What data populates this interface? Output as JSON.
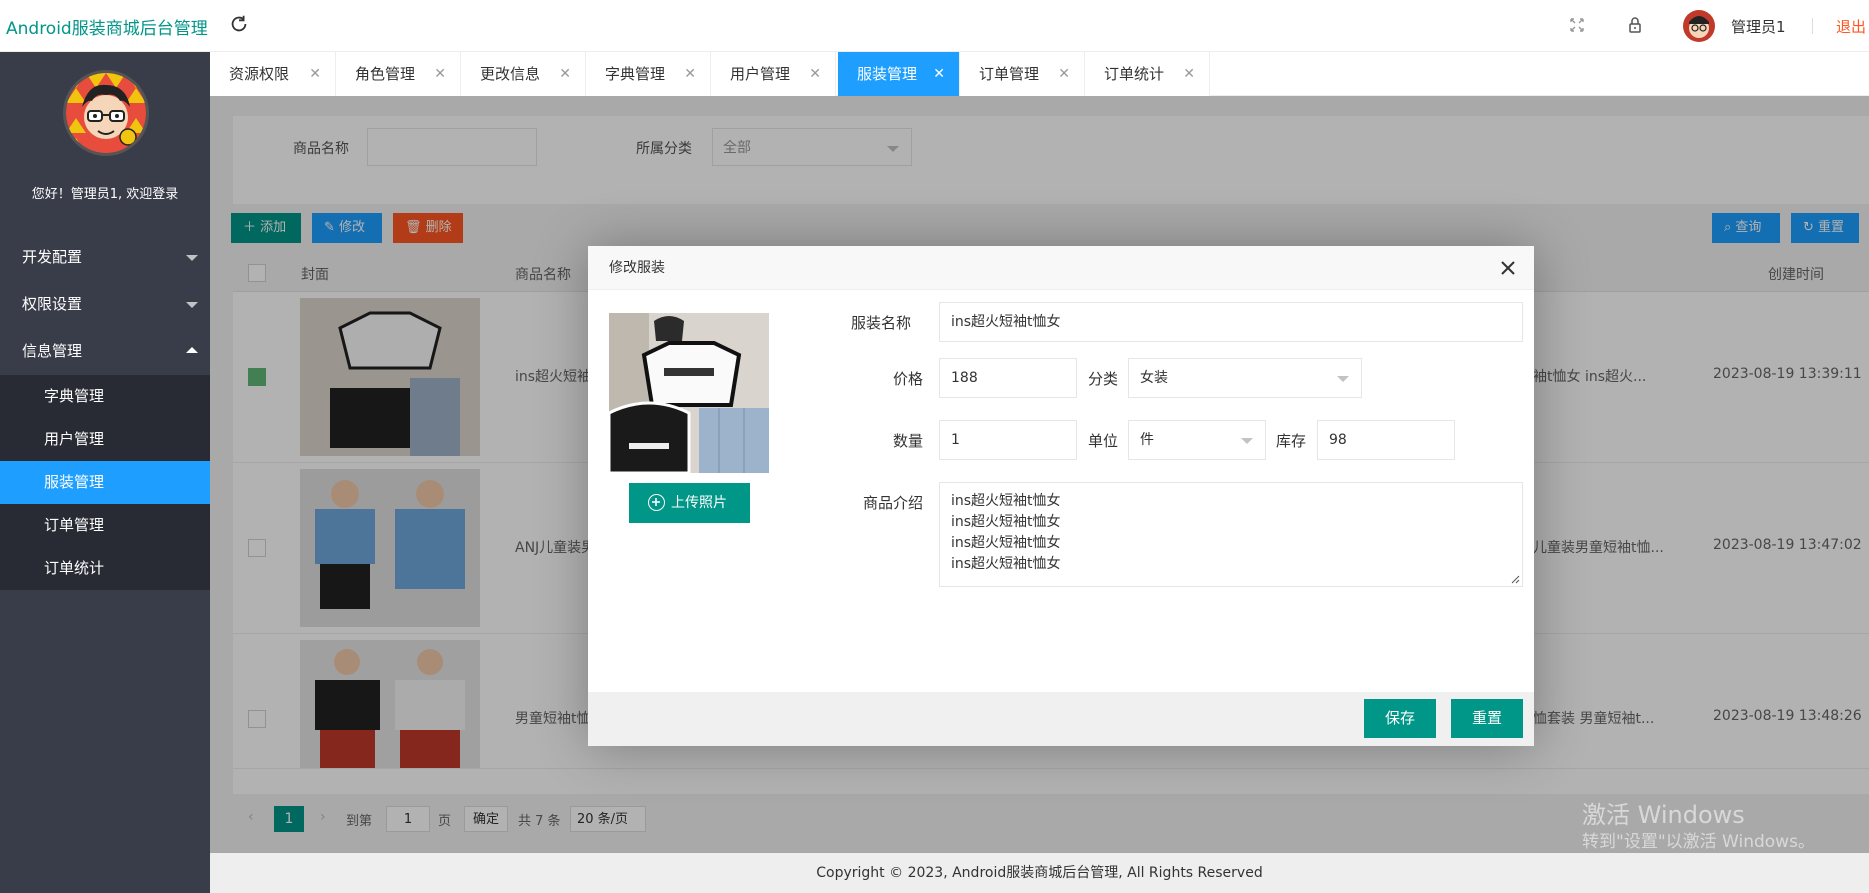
{
  "app": {
    "title": "Android服装商城后台管理"
  },
  "topbar": {
    "admin_name": "管理员1",
    "logout": "退出"
  },
  "sidebar": {
    "welcome": "您好！管理员1, 欢迎登录",
    "groups": [
      {
        "label": "开发配置"
      },
      {
        "label": "权限设置"
      },
      {
        "label": "信息管理"
      }
    ],
    "sub_items": [
      {
        "label": "字典管理"
      },
      {
        "label": "用户管理"
      },
      {
        "label": "服装管理"
      },
      {
        "label": "订单管理"
      },
      {
        "label": "订单统计"
      }
    ]
  },
  "tabs": [
    {
      "label": "资源权限"
    },
    {
      "label": "角色管理"
    },
    {
      "label": "更改信息"
    },
    {
      "label": "字典管理"
    },
    {
      "label": "用户管理"
    },
    {
      "label": "服装管理"
    },
    {
      "label": "订单管理"
    },
    {
      "label": "订单统计"
    }
  ],
  "search": {
    "name_label": "商品名称",
    "category_label": "所属分类",
    "category_value": "全部",
    "query": "查询",
    "reset": "重置"
  },
  "toolbar": {
    "add": "添加",
    "edit": "修改",
    "delete": "删除"
  },
  "table": {
    "headers": {
      "cover": "封面",
      "name": "商品名称",
      "created": "创建时间"
    },
    "rows": [
      {
        "name": "ins超火短袖",
        "desc": "袖t恤女 ins超火...",
        "created": "2023-08-19 13:39:11"
      },
      {
        "name": "ANJ儿童装男",
        "desc": "儿童装男童短袖t恤...",
        "created": "2023-08-19 13:47:02"
      },
      {
        "name": "男童短袖t恤",
        "desc": "恤套装 男童短袖t...",
        "created": "2023-08-19 13:48:26"
      }
    ]
  },
  "pagination": {
    "current": "1",
    "goto": "到第",
    "page_input": "1",
    "page_unit": "页",
    "confirm": "确定",
    "total": "共 7 条",
    "per_page": "20 条/页"
  },
  "footer": {
    "copyright": "Copyright © 2023, Android服装商城后台管理, All Rights Reserved"
  },
  "watermark": {
    "line1": "激活 Windows",
    "line2": "转到\"设置\"以激活 Windows。"
  },
  "modal": {
    "title": "修改服装",
    "upload": "上传照片",
    "name_label": "服装名称",
    "name_value": "ins超火短袖t恤女",
    "price_label": "价格",
    "price_value": "188",
    "category_label": "分类",
    "category_value": "女装",
    "qty_label": "数量",
    "qty_value": "1",
    "unit_label": "单位",
    "unit_value": "件",
    "stock_label": "库存",
    "stock_value": "98",
    "intro_label": "商品介绍",
    "intro_lines": [
      "ins超火短袖t恤女",
      "ins超火短袖t恤女",
      "ins超火短袖t恤女",
      "ins超火短袖t恤女"
    ],
    "save": "保存",
    "reset": "重置"
  },
  "colors": {
    "primary": "#009688",
    "blue": "#1e9fff",
    "danger": "#ff5722",
    "sidebar": "#393d49"
  }
}
